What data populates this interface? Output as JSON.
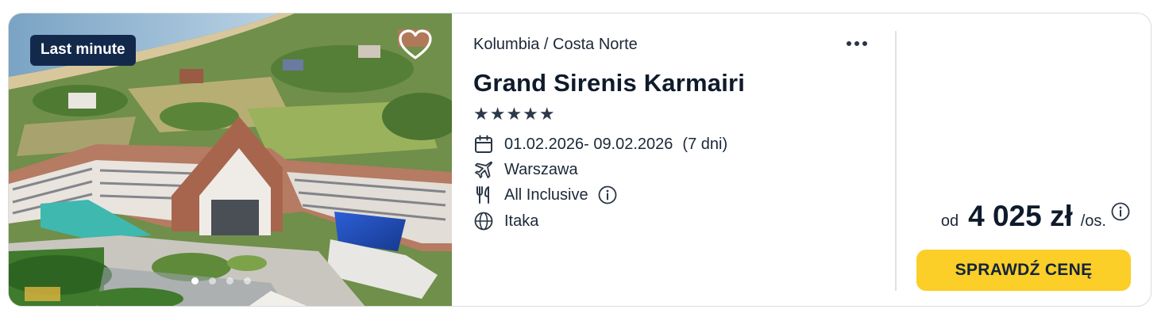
{
  "offer": {
    "badge": "Last minute",
    "photo_alt": "Grand Sirenis Karmairi",
    "carousel_dots": 4,
    "carousel_active": 0,
    "location": "Kolumbia / Costa Norte",
    "hotel_name": "Grand Sirenis Karmairi",
    "stars": "★★★★★",
    "star_rating": 5,
    "dates": "01.02.2026- 09.02.2026",
    "duration": "(7 dni)",
    "departure": "Warszawa",
    "board": "All Inclusive",
    "operator": "Itaka",
    "price": {
      "prefix": "od",
      "amount": "4 025 zł",
      "suffix": "/os."
    },
    "cta_label": "SPRAWDŹ CENĘ"
  },
  "icons": {
    "favorite": "heart-outline-icon",
    "more": "more-horizontal-icon",
    "calendar": "calendar-icon",
    "flight": "airplane-icon",
    "board": "cutlery-icon",
    "info": "info-icon",
    "operator": "globe-icon"
  },
  "colors": {
    "badge_bg": "#13294b",
    "cta_bg": "#fbce28",
    "text": "#1c2838",
    "border": "#d7dbe0"
  }
}
